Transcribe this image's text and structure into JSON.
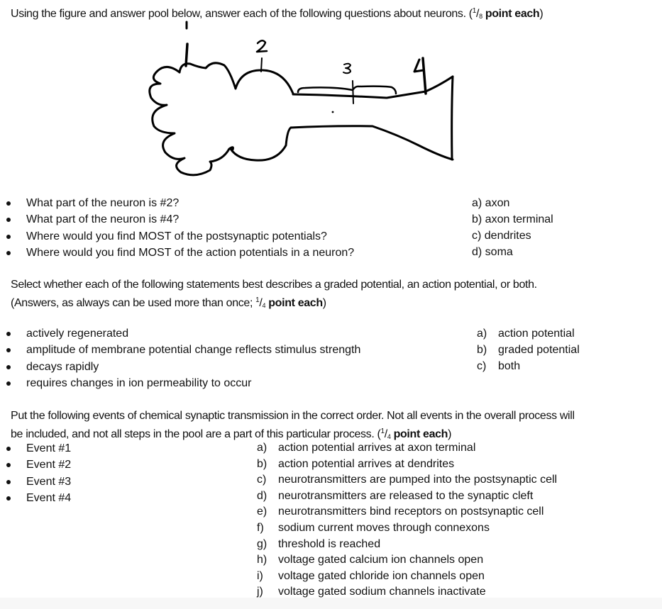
{
  "section1": {
    "instruction": "Using the figure and answer pool below, answer each of the following questions about neurons. (",
    "points_num": "1",
    "points_den": "8",
    "points_suffix": " point each",
    "close_paren": ")",
    "figure": {
      "labels": [
        "1",
        "2",
        "3",
        "4"
      ],
      "description": "hand-drawn neuron with dendrites (1), soma (2), axon (3), axon terminal (4)"
    },
    "questions": [
      "What part of the neuron is #2?",
      "What part of the neuron is #4?",
      "Where would you find MOST of the postsynaptic potentials?",
      "Where would you find MOST of the action potentials in a neuron?"
    ],
    "answers": [
      "a) axon",
      "b) axon terminal",
      "c) dendrites",
      "d) soma"
    ]
  },
  "section2": {
    "instruction_line1": "Select whether each of the following statements best describes a graded potential, an action potential, or both.",
    "instruction_line2": "(Answers, as always can be used more than once; ",
    "points_num": "1",
    "points_den": "4",
    "points_suffix": " point each",
    "close_paren": ")",
    "statements": [
      "actively regenerated",
      "amplitude of membrane potential change reflects stimulus strength",
      "decays rapidly",
      "requires changes in ion permeability to occur"
    ],
    "answers": [
      {
        "label": "a)",
        "text": "action potential"
      },
      {
        "label": "b)",
        "text": "graded potential"
      },
      {
        "label": "c)",
        "text": "both"
      }
    ]
  },
  "section3": {
    "instruction_line1": "Put the following events of chemical synaptic transmission in the correct order. Not all events in the overall process will",
    "instruction_line2": "be included, and not all steps in the pool are a part of this particular process. (",
    "points_num": "1",
    "points_den": "4",
    "points_suffix": " point each",
    "close_paren": ")",
    "events": [
      "Event #1",
      "Event #2",
      "Event #3",
      "Event #4"
    ],
    "pool": [
      {
        "label": "a)",
        "text": "action potential arrives at axon terminal"
      },
      {
        "label": "b)",
        "text": "action potential arrives at dendrites"
      },
      {
        "label": "c)",
        "text": "neurotransmitters are pumped into the postsynaptic cell"
      },
      {
        "label": "d)",
        "text": "neurotransmitters are released to the synaptic cleft"
      },
      {
        "label": "e)",
        "text": "neurotransmitters bind receptors on postsynaptic cell"
      },
      {
        "label": "f)",
        "text": "sodium current moves through connexons"
      },
      {
        "label": "g)",
        "text": "threshold is reached"
      },
      {
        "label": "h)",
        "text": "voltage gated calcium ion channels open"
      },
      {
        "label": "i)",
        "text": "voltage gated chloride ion channels open"
      },
      {
        "label": "j)",
        "text": "voltage gated sodium channels inactivate"
      }
    ]
  }
}
